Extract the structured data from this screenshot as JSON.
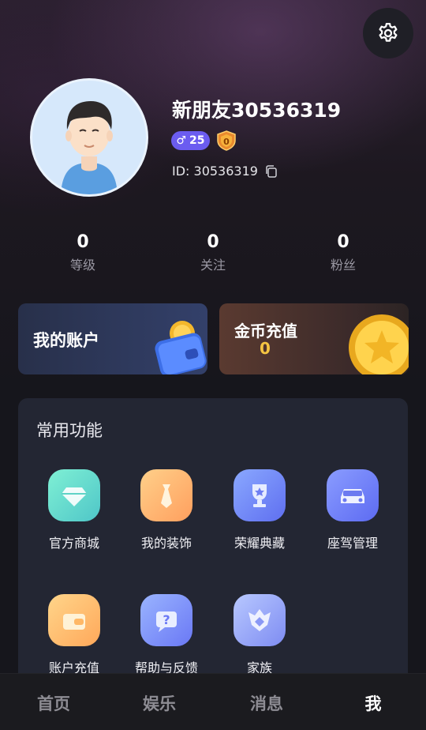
{
  "profile": {
    "username": "新朋友30536319",
    "gender_symbol": "♂",
    "age": "25",
    "level_badge_value": "0",
    "id_text": "ID: 30536319"
  },
  "stats": [
    {
      "value": "0",
      "label": "等级"
    },
    {
      "value": "0",
      "label": "关注"
    },
    {
      "value": "0",
      "label": "粉丝"
    }
  ],
  "cards": {
    "account_title": "我的账户",
    "coin_title": "金币充值",
    "coin_value": "0"
  },
  "functions": {
    "title": "常用功能",
    "items": [
      {
        "label": "官方商城",
        "icon": "diamond-icon"
      },
      {
        "label": "我的装饰",
        "icon": "tie-icon"
      },
      {
        "label": "荣耀典藏",
        "icon": "trophy-icon"
      },
      {
        "label": "座驾管理",
        "icon": "car-icon"
      },
      {
        "label": "账户充值",
        "icon": "wallet-icon"
      },
      {
        "label": "帮助与反馈",
        "icon": "help-icon"
      },
      {
        "label": "家族",
        "icon": "family-icon"
      }
    ]
  },
  "tabs": [
    {
      "label": "首页"
    },
    {
      "label": "娱乐"
    },
    {
      "label": "消息"
    },
    {
      "label": "我",
      "active": true
    }
  ],
  "colors": {
    "accent_purple": "#6b5cf0",
    "coin_gold": "#f5c542",
    "background": "#16161c"
  }
}
